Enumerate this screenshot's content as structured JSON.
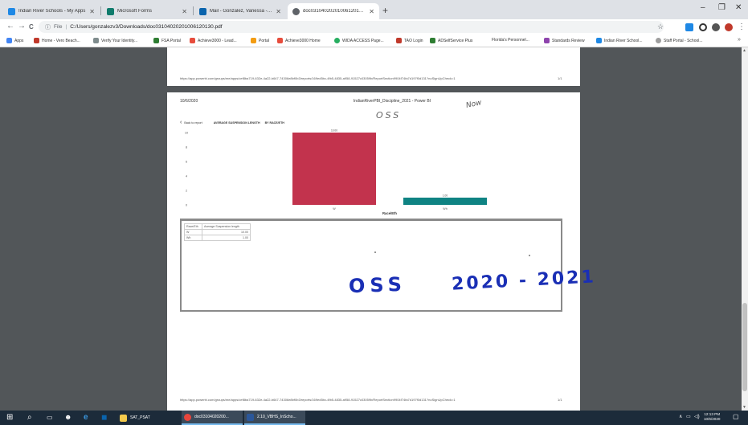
{
  "browser": {
    "tabs": [
      {
        "label": "Indian River Schools - My Apps",
        "icon": "my-apps-favicon",
        "color": "#1e88e5",
        "active": false
      },
      {
        "label": "Microsoft Forms",
        "icon": "forms-favicon",
        "color": "#0f7b6c",
        "active": false
      },
      {
        "label": "Mail - Gonzalez, Vanessa - Outlo",
        "icon": "outlook-favicon",
        "color": "#0a64ad",
        "active": false
      },
      {
        "label": "doc03104020201006120130.pdf",
        "icon": "pdf-favicon",
        "color": "#5f6368",
        "active": true
      }
    ],
    "new_tab": "+",
    "window_controls": {
      "minimize": "–",
      "restore": "❐",
      "close": "✕"
    },
    "toolbar": {
      "back": "←",
      "forward": "→",
      "reload": "C",
      "info_icon": "ⓘ",
      "scheme": "File",
      "separator": "|",
      "url": "C:/Users/gonzalezv3/Downloads/doc03104020201006120130.pdf",
      "star": "☆",
      "menu": "⋮"
    },
    "bookmarks": [
      {
        "label": "Apps",
        "color": "#4285f4"
      },
      {
        "label": "Home - Vero Beach...",
        "color": "#c0392b"
      },
      {
        "label": "Verify Your Identity...",
        "color": "#7f8c8d"
      },
      {
        "label": "FSA Portal",
        "color": "#2e7d32"
      },
      {
        "label": "Achieve3000 - Lead...",
        "color": "#e74c3c"
      },
      {
        "label": "Portal",
        "color": "#f39c12"
      },
      {
        "label": "Achieve3000 Home",
        "color": "#e74c3c"
      },
      {
        "label": "WIDA ACCESS Page...",
        "color": "#27ae60"
      },
      {
        "label": "TAO Login",
        "color": "#c0392b"
      },
      {
        "label": "ADSelfService Plus",
        "color": "#2e7d32"
      },
      {
        "label": "Florida's Personnel...",
        "color": "#ffffff"
      },
      {
        "label": "Standards Review",
        "color": "#8e44ad"
      },
      {
        "label": "Indian River School...",
        "color": "#1e88e5"
      },
      {
        "label": "Staff Portal - School...",
        "color": "#9e9e9e"
      }
    ],
    "bookmarks_more": "»"
  },
  "pdf": {
    "page1_footer_url": "https://app.powerbi.com/groups/me/apps/cef8ba719-632e-4a22-b647-74306e8bf0b3/reports/169ed5bc-4fb5-4835-a958-91527c03059b/ReportSection9904f74fa7d197f0d131?noSignUpCheck=1",
    "page1_footer_page": "1/1",
    "date": "10/6/2020",
    "report_title": "IndianRiverPBI_Discipline_2021 - Power BI",
    "handwriting": {
      "now": "Now",
      "oss_top": "OSS",
      "oss_bottom": "OSS",
      "year": "2020 - 2021"
    },
    "visual_header": {
      "back_icon": "‹",
      "back_label": "Back to report",
      "title": "AVERAGE SUSPENSION LENGTH",
      "subtitle": "BY RACE/ETH"
    },
    "table": {
      "headers": [
        "Race/Eth",
        "Average Suspension length"
      ],
      "rows": [
        [
          "W",
          "10.00"
        ],
        [
          "Wh",
          "1.00"
        ]
      ]
    },
    "page2_footer_url": "https://app.powerbi.com/groups/me/apps/cef8ba719-632e-4a22-b647-74306e8bf0b3/reports/169ed5bc-4fb5-4835-a958-91527c03059b/ReportSection9904f74fa7d197f0d131?noSignUpCheck=1",
    "page2_footer_page": "1/1"
  },
  "chart_data": {
    "type": "bar",
    "categories": [
      "W",
      "Wh"
    ],
    "values": [
      10.0,
      1.0
    ],
    "data_labels": [
      "10.00",
      "1.00"
    ],
    "colors": [
      "#c2334d",
      "#0f8383"
    ],
    "xlabel": "Race/Eth",
    "ylabel": "",
    "ylim": [
      0,
      10
    ],
    "yticks": [
      0,
      2,
      4,
      6,
      8,
      10
    ],
    "grid": false
  },
  "taskbar": {
    "apps": [
      {
        "label": "SAT_PSAT",
        "icon": "folder-icon",
        "color": "#f2c94c",
        "active": false
      },
      {
        "label": "doc03104020200...",
        "icon": "chrome-icon",
        "color": "#e8453c",
        "active": true
      },
      {
        "label": "2.10_VBHS_InScho...",
        "icon": "word-icon",
        "color": "#2b579a",
        "active": true
      }
    ],
    "clock_time": "12:13 PM",
    "clock_date": "10/6/2020"
  }
}
